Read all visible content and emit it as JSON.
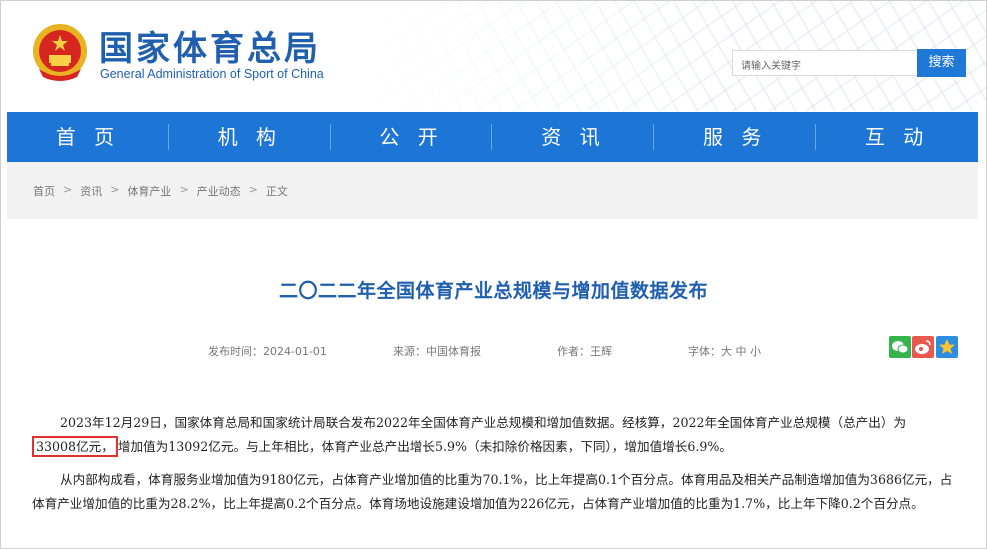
{
  "header": {
    "title": "国家体育总局",
    "subtitle": "General Administration of Sport of China",
    "search_placeholder": "请输入关键字",
    "search_button": "搜索"
  },
  "nav": [
    "首 页",
    "机 构",
    "公 开",
    "资 讯",
    "服 务",
    "互 动"
  ],
  "breadcrumb": [
    "首页",
    "资讯",
    "体育产业",
    "产业动态",
    "正文"
  ],
  "breadcrumb_sep": ">",
  "article": {
    "title": "二〇二二年全国体育产业总规模与增加值数据发布",
    "meta": {
      "publish_time": "发布时间：2024-01-01",
      "source": "来源：中国体育报",
      "author": "作者：王辉",
      "font_size": "字体：大 中 小"
    },
    "p1_a": "2023年12月29日，国家体育总局和国家统计局联合发布2022年全国体育产业总规模和增加值数据。经核算，2022年全国体育产业总规模（总产出）为",
    "p1_highlight": "33008亿元，",
    "p1_b": "增加值为13092亿元。与上年相比，体育产业总产出增长5.9%（未扣除价格因素，下同），增加值增长6.9%。",
    "p2": "从内部构成看，体育服务业增加值为9180亿元，占体育产业增加值的比重为70.1%，比上年提高0.1个百分点。体育用品及相关产品制造增加值为3686亿元，占体育产业增加值的比重为28.2%，比上年提高0.2个百分点。体育场地设施建设增加值为226亿元，占体育产业增加值的比重为1.7%，比上年下降0.2个百分点。"
  },
  "colors": {
    "brand_blue": "#1f5fae",
    "nav_blue": "#1d75d6",
    "highlight_red": "#e03131"
  },
  "icons": [
    "national-emblem-icon",
    "wechat-share-icon",
    "weibo-share-icon",
    "favorite-star-icon"
  ]
}
